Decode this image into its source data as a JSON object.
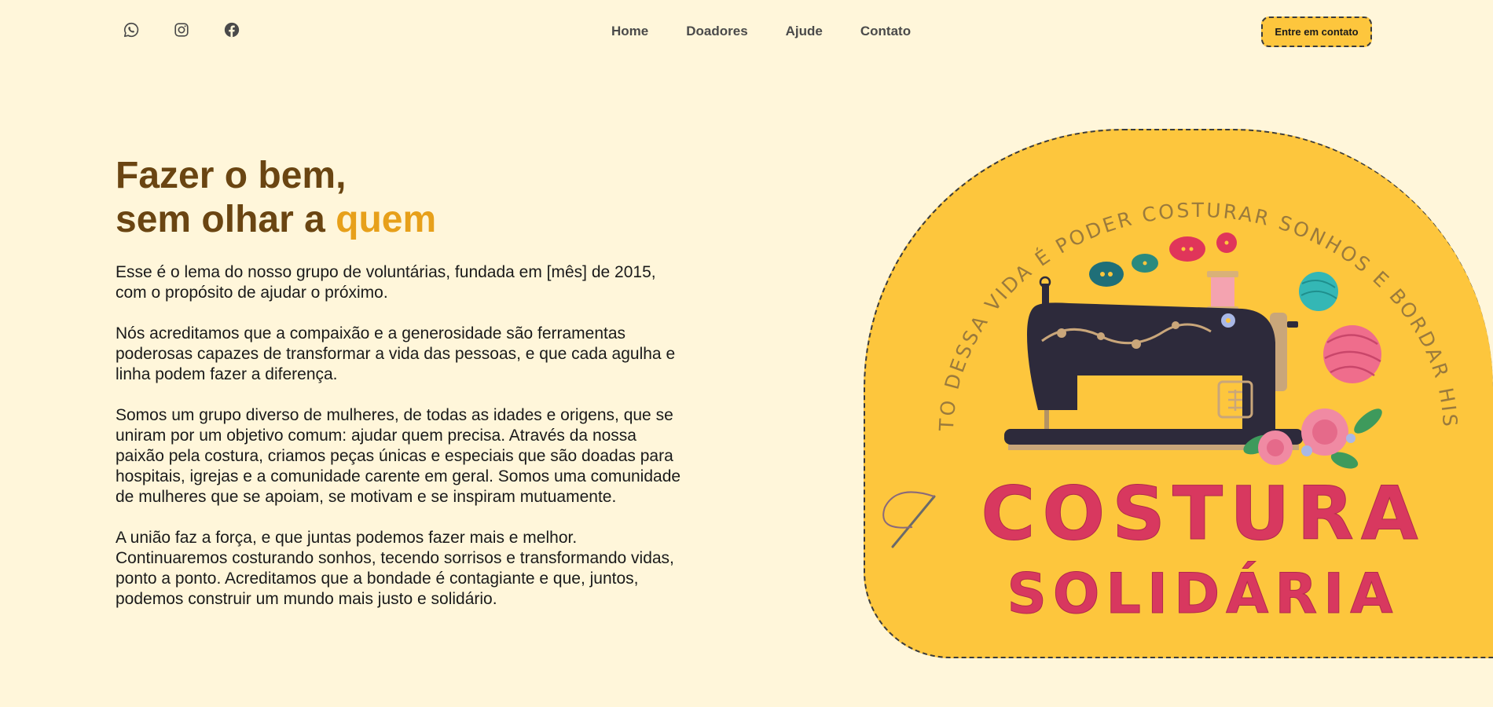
{
  "header": {
    "social": [
      {
        "name": "whatsapp",
        "icon": "whatsapp-icon"
      },
      {
        "name": "instagram",
        "icon": "instagram-icon"
      },
      {
        "name": "facebook",
        "icon": "facebook-icon"
      }
    ],
    "nav": [
      "Home",
      "Doadores",
      "Ajude",
      "Contato"
    ],
    "cta_label": "Entre em contato"
  },
  "hero": {
    "title_line1": "Fazer o bem,",
    "title_line2_prefix": "sem olhar a ",
    "title_line2_accent": "quem",
    "paragraphs": [
      "Esse é o lema do nosso grupo de voluntárias, fundada em [mês] de 2015, com o propósito de ajudar o próximo.",
      "Nós acreditamos que a compaixão e a generosidade são ferramentas poderosas capazes de transformar a vida das pessoas, e que cada agulha e linha podem fazer a diferença.",
      "Somos um grupo diverso de mulheres, de todas as idades e origens, que se uniram por um objetivo comum: ajudar quem precisa. Através da nossa paixão pela costura, criamos peças únicas e especiais que são doadas para hospitais, igrejas e a comunidade carente em geral. Somos uma comunidade de mulheres que se apoiam, se motivam e se inspiram mutuamente.",
      "A união faz a força, e que juntas podemos fazer mais e melhor. Continuaremos costurando sonhos, tecendo sorrisos e transformando vidas, ponto a ponto. Acreditamos que a bondade é contagiante e que, juntos, podemos construir um mundo mais justo e solidário."
    ]
  },
  "logo": {
    "arc_text": "O BONITO DESSA VIDA É PODER COSTURAR SONHOS E BORDAR HISTÓRIAS",
    "word1": "COSTURA",
    "word2": "SOLIDÁRIA"
  },
  "colors": {
    "background": "#fff6da",
    "brand_yellow": "#fdc63d",
    "title_brown": "#6a4512",
    "accent_orange": "#e7a01a",
    "logo_red": "#d8385f"
  }
}
